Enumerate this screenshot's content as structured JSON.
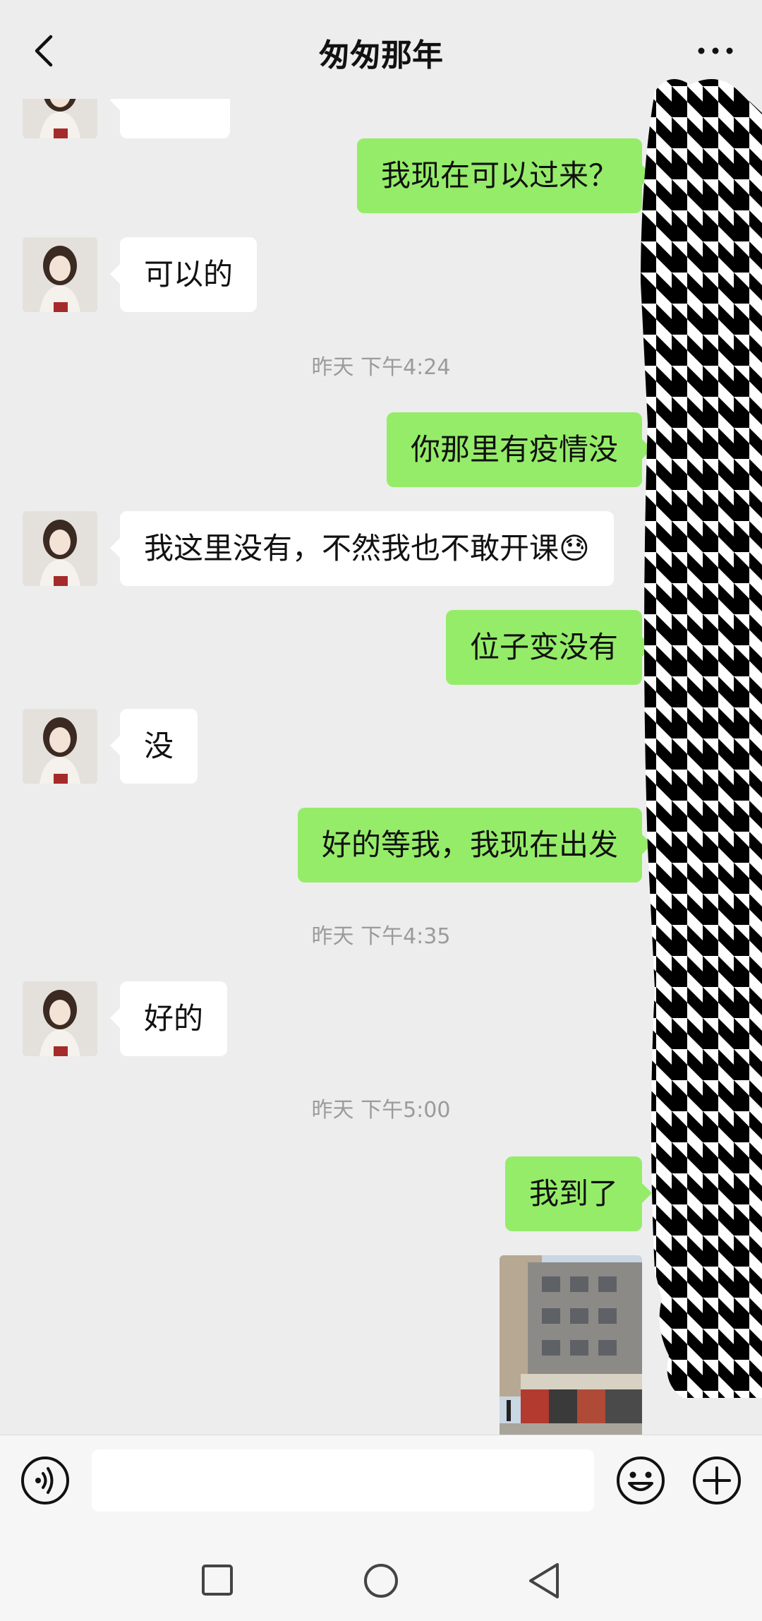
{
  "header": {
    "title": "匆匆那年",
    "back_icon": "chevron-left-icon",
    "more_icon": "more-dots-icon"
  },
  "messages": [
    {
      "side": "out",
      "text": "我现在可以过来？"
    },
    {
      "side": "in",
      "text": "可以的"
    },
    {
      "type": "timestamp",
      "text": "昨天 下午4:24"
    },
    {
      "side": "out",
      "text": "你那里有疫情没"
    },
    {
      "side": "in",
      "text": "我这里没有，不然我也不敢开课😓"
    },
    {
      "side": "out",
      "text": "位子变没有"
    },
    {
      "side": "in",
      "text": "没"
    },
    {
      "side": "out",
      "text": "好的等我，我现在出发"
    },
    {
      "type": "timestamp",
      "text": "昨天 下午4:35"
    },
    {
      "side": "in",
      "text": "好的"
    },
    {
      "type": "timestamp",
      "text": "昨天 下午5:00"
    },
    {
      "side": "out",
      "text": "我到了"
    },
    {
      "side": "out",
      "type": "image",
      "subject": "street-photo"
    }
  ],
  "input_bar": {
    "voice_icon": "voice-icon",
    "emoji_icon": "emoji-icon",
    "plus_icon": "plus-icon",
    "placeholder": ""
  },
  "colors": {
    "background": "#ededed",
    "outgoing_bubble": "#95ec69",
    "incoming_bubble": "#ffffff",
    "timestamp": "#9b9b9b"
  }
}
